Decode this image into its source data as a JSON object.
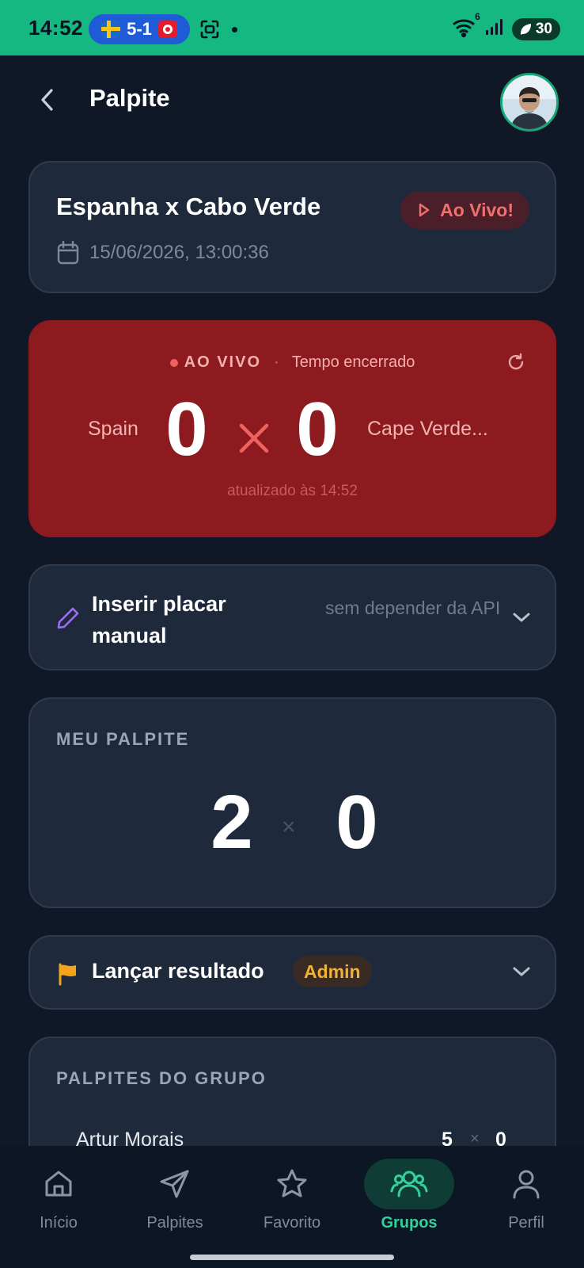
{
  "status_bar": {
    "time": "14:52",
    "live_score": "5-1",
    "battery": "30",
    "wifi_badge": "6",
    "icons": [
      "sweden-flag-icon",
      "tunisia-flag-icon",
      "screenshot-icon",
      "wifi-icon",
      "signal-icon",
      "battery-icon"
    ]
  },
  "header": {
    "title": "Palpite",
    "back_icon": "chevron-left-icon",
    "avatar": "user-avatar"
  },
  "match": {
    "title": "Espanha x Cabo Verde",
    "live_chip": "Ao Vivo!",
    "datetime": "15/06/2026, 13:00:36"
  },
  "live_score": {
    "live_label": "AO VIVO",
    "separator": "·",
    "status": "Tempo encerrado",
    "home_team": "Spain",
    "away_team": "Cape Verde...",
    "home_goals": "0",
    "away_goals": "0",
    "updated": "atualizado às 14:52",
    "colors": {
      "card": "#8c1a1e",
      "accent": "#f0625f"
    }
  },
  "manual_score": {
    "title": "Inserir placar manual",
    "hint": "sem depender da API"
  },
  "my_guess": {
    "label": "MEU PALPITE",
    "home": "2",
    "away": "0",
    "separator": "×"
  },
  "result": {
    "title": "Lançar resultado",
    "badge": "Admin"
  },
  "group_guesses": {
    "label": "PALPITES DO GRUPO",
    "rows": [
      {
        "name": "Artur Morais",
        "home": "5",
        "separator": "×",
        "away": "0"
      }
    ]
  },
  "nav": {
    "items": [
      {
        "label": "Início",
        "icon": "home-icon"
      },
      {
        "label": "Palpites",
        "icon": "send-icon"
      },
      {
        "label": "Favorito",
        "icon": "star-icon"
      },
      {
        "label": "Grupos",
        "icon": "users-icon",
        "active": true
      },
      {
        "label": "Perfil",
        "icon": "user-icon"
      }
    ],
    "active_color": "#35d09a"
  },
  "theme": {
    "background": "#101828",
    "card": "#1e2a3c",
    "status_bar": "#14b880"
  }
}
